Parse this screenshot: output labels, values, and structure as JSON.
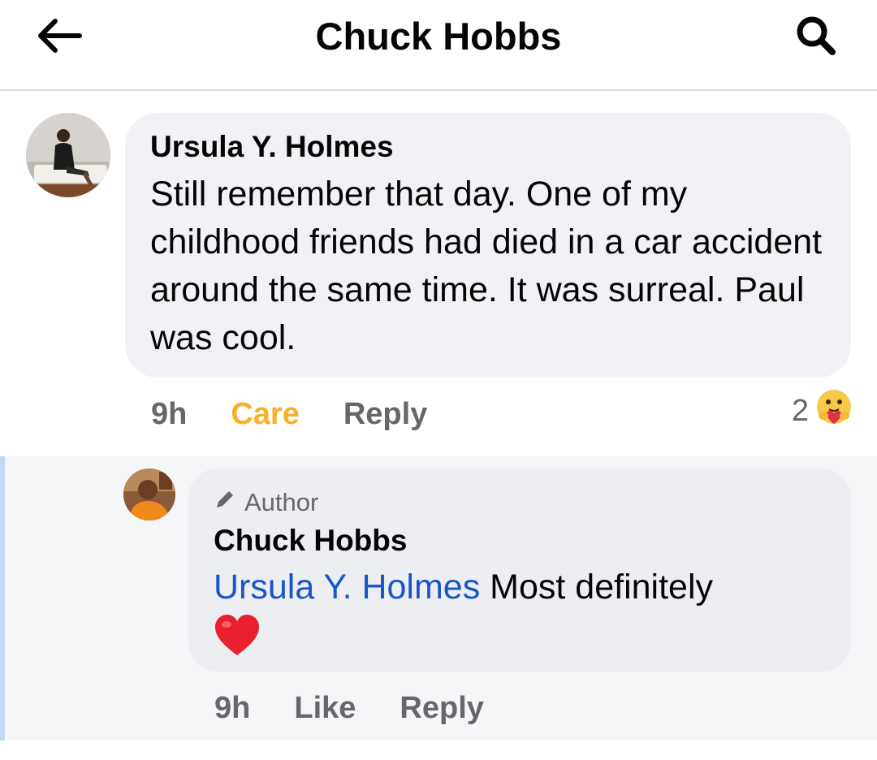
{
  "header": {
    "title": "Chuck Hobbs",
    "back_icon": "arrow-left-icon",
    "search_icon": "search-icon"
  },
  "comments": [
    {
      "author": "Ursula Y. Holmes",
      "text": "Still remember that day. One of my childhood friends had died in a car accident around the same time. It was surreal. Paul was cool.",
      "time": "9h",
      "reaction_label": "Care",
      "reply_label": "Reply",
      "reaction_count": "2",
      "reaction_icon": "care-emoji-icon"
    }
  ],
  "reply": {
    "badge": "Author",
    "author": "Chuck Hobbs",
    "mention": "Ursula Y. Holmes",
    "text": "Most definitely",
    "emoji_icon": "heart-emoji-icon",
    "time": "9h",
    "like_label": "Like",
    "reply_label": "Reply"
  },
  "colors": {
    "care": "#f7b125",
    "mention": "#1a56c9",
    "bubble": "#f0f2f5",
    "secondary_text": "#65676b",
    "thread_line": "#c6d6f7"
  }
}
